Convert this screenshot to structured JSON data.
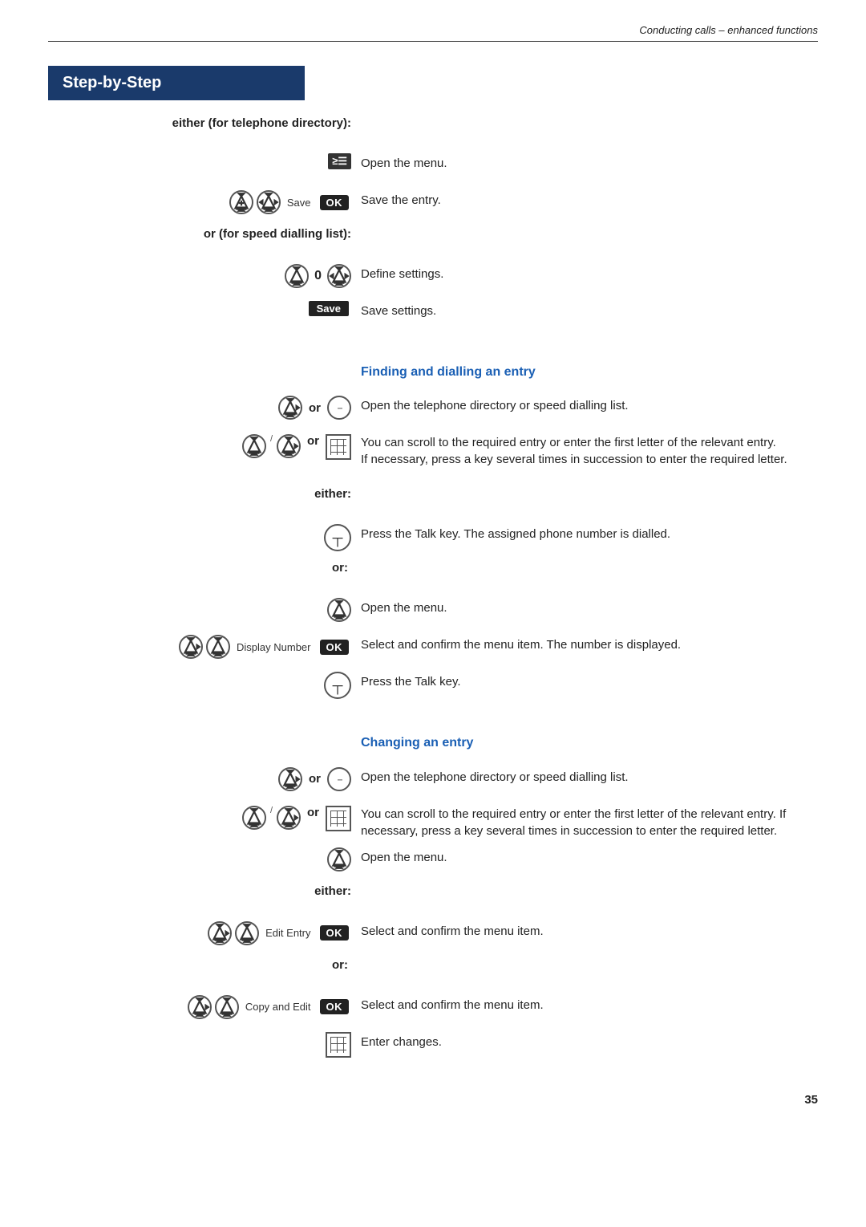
{
  "header": {
    "title": "Conducting calls – enhanced functions"
  },
  "step_by_step": {
    "label": "Step-by-Step"
  },
  "sections": {
    "either_tel_dir": "either (for telephone directory):",
    "or_speed_dial": "or (for speed dialling list):",
    "finding_heading": "Finding and dialling an entry",
    "changing_heading": "Changing an entry"
  },
  "rows": [
    {
      "id": "open-menu-1",
      "right": "Open the menu."
    },
    {
      "id": "save-entry",
      "left_label": "Save",
      "right": "Save the entry."
    },
    {
      "id": "define-settings",
      "right": "Define settings."
    },
    {
      "id": "save-settings",
      "right": "Save settings."
    },
    {
      "id": "open-tel-dir",
      "right": "Open the telephone directory or speed dialling list."
    },
    {
      "id": "scroll-entry",
      "right": "You can scroll to the required entry or enter the first letter of the relevant entry.\nIf necessary, press a key several times in succession to enter the required letter."
    },
    {
      "id": "either-label",
      "label": "either:"
    },
    {
      "id": "press-talk-1",
      "right": "Press the Talk key. The assigned phone number is dialled."
    },
    {
      "id": "or-label-1",
      "label": "or:"
    },
    {
      "id": "open-menu-2",
      "right": "Open the menu."
    },
    {
      "id": "display-number",
      "left_label": "Display Number",
      "right": "Select and confirm the menu item. The number is displayed."
    },
    {
      "id": "press-talk-2",
      "right": "Press the Talk key."
    },
    {
      "id": "open-tel-dir-2",
      "right": "Open the telephone directory or speed dialling list."
    },
    {
      "id": "scroll-entry-2",
      "right": "You can scroll to the required entry or enter the first letter of the relevant entry. If necessary, press a key several times in succession to enter the required letter."
    },
    {
      "id": "open-menu-3",
      "right": "Open the menu."
    },
    {
      "id": "either-label-2",
      "label": "either:"
    },
    {
      "id": "edit-entry",
      "left_label": "Edit Entry",
      "right": "Select and confirm the menu item."
    },
    {
      "id": "or-label-2",
      "label": "or:"
    },
    {
      "id": "copy-edit",
      "left_label": "Copy and Edit",
      "right": "Select and confirm the menu item."
    },
    {
      "id": "enter-changes",
      "right": "Enter changes."
    }
  ],
  "page_number": "35"
}
